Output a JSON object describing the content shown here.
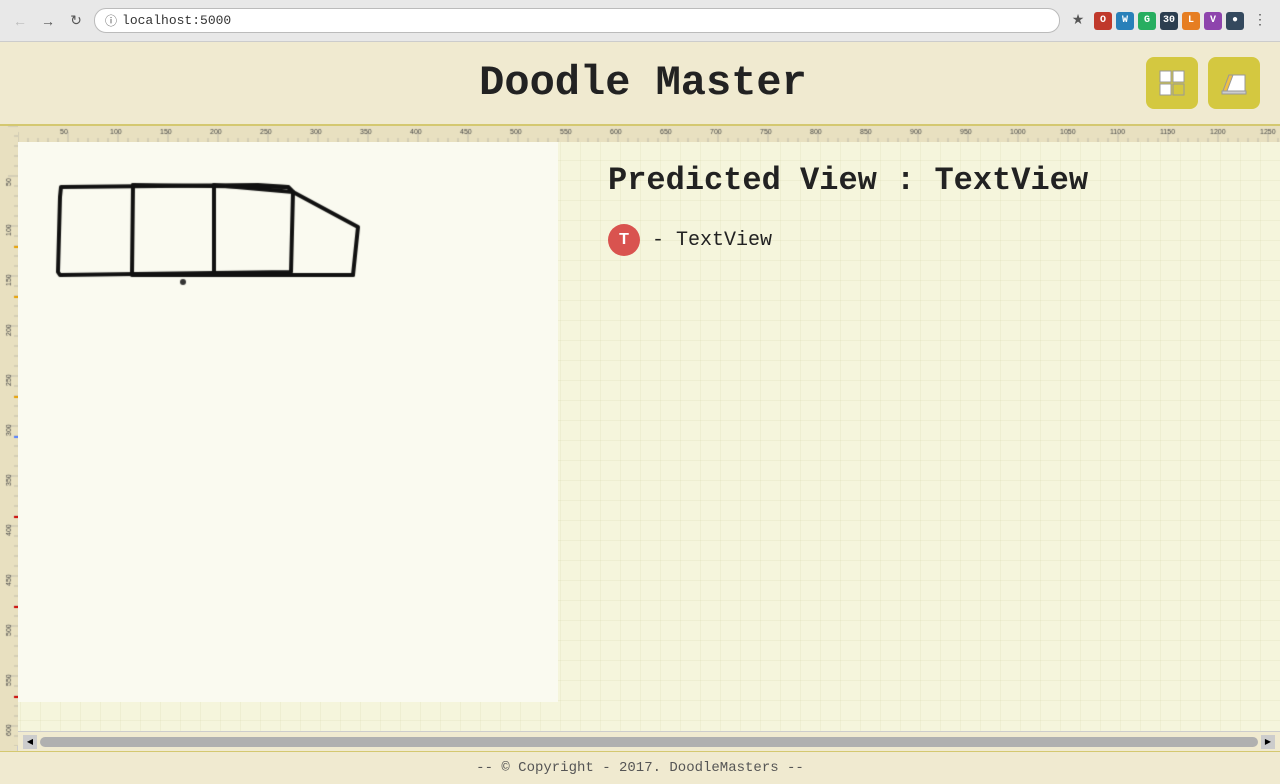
{
  "browser": {
    "url": "localhost:5000",
    "back_disabled": true,
    "forward_disabled": true
  },
  "header": {
    "title": "Doodle Master",
    "icon_grid_label": "grid-icon",
    "icon_eraser_label": "eraser-icon"
  },
  "prediction": {
    "title": "Predicted View : TextView",
    "badge_letter": "T",
    "item_label": "- TextView"
  },
  "footer": {
    "copyright": "-- © Copyright - 2017. DoodleMasters --"
  },
  "colors": {
    "background": "#f5f5dc",
    "header_bg": "#f0ead0",
    "badge_red": "#d9534f",
    "ruler_bg": "#e8e0c0",
    "title_color": "#222222",
    "accent_yellow": "#d4c840"
  }
}
